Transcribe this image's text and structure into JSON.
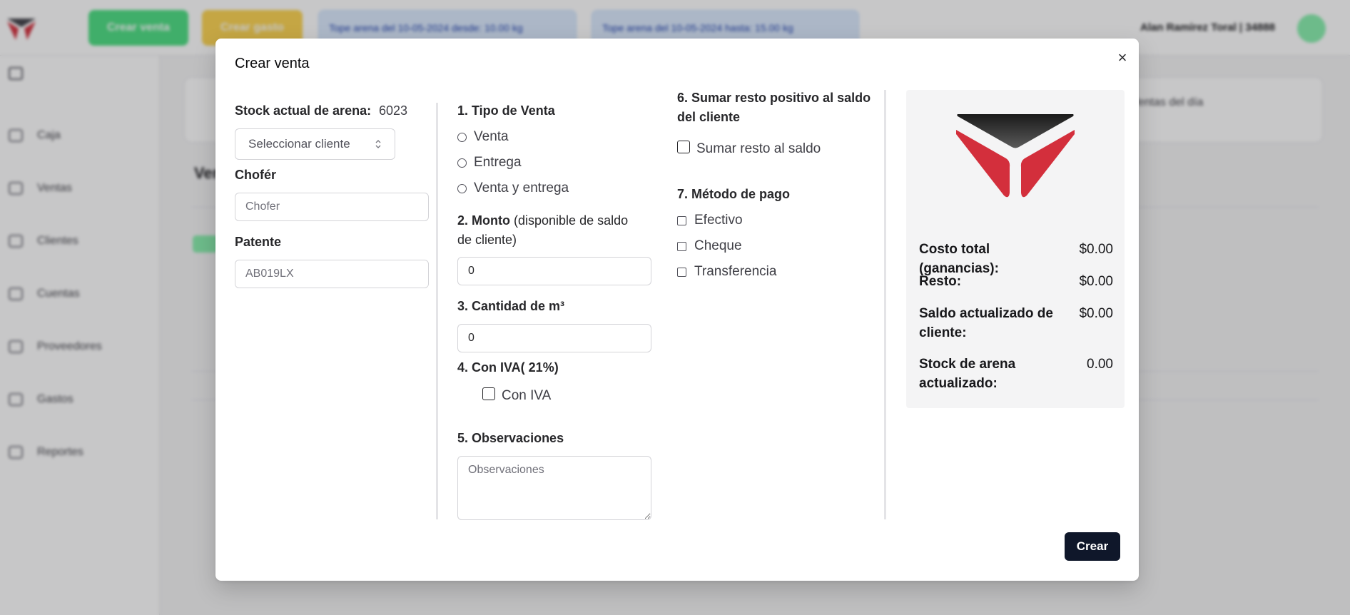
{
  "background": {
    "top_buttons": {
      "green_label": "Crear venta",
      "amber_label": "Crear gasto"
    },
    "info_pills": [
      "Tope arena del 10-05-2024 desde: 10.00 kg",
      "Tope arena del 10-05-2024 hasta: 15.00 kg"
    ],
    "user_name": "Alan Ramírez Toral | 34888",
    "sidebar_items": [
      "Caja",
      "Ventas",
      "Clientes",
      "Cuentas",
      "Proveedores",
      "Gastos",
      "Reportes"
    ],
    "card_text": "Ventas del día",
    "heading": "Ventas"
  },
  "modal": {
    "title": "Crear venta",
    "close_glyph": "×",
    "stock": {
      "label": "Stock actual de arena:",
      "value": "6023"
    },
    "client_select": {
      "value": "Seleccionar cliente",
      "chevron": "⌃⌄"
    },
    "chofer": {
      "label": "Chofér",
      "placeholder": "Chofer",
      "value": ""
    },
    "patente": {
      "label": "Patente",
      "placeholder": "AB019LX",
      "value": ""
    },
    "tipo_venta": {
      "label": "1. Tipo de Venta",
      "options": [
        "Venta",
        "Entrega",
        "Venta y entrega"
      ]
    },
    "monto": {
      "label": "2. Monto",
      "label_extra": "(disponible de saldo",
      "label_extra_2": "de cliente)",
      "value": "0"
    },
    "cantidad": {
      "label": "3. Cantidad de m³",
      "value": "0"
    },
    "iva": {
      "label": "4. Con IVA( 21%)",
      "checkbox_label": "Con IVA"
    },
    "observaciones": {
      "label": "5. Observaciones",
      "placeholder": "Observaciones"
    },
    "sumar_resto": {
      "label_line1": "6. Sumar resto positivo al saldo",
      "label_line2": "del cliente",
      "checkbox_label": "Sumar resto al saldo"
    },
    "metodo_pago": {
      "label": "7. Método de pago",
      "options": [
        "Efectivo",
        "Cheque",
        "Transferencia"
      ]
    },
    "summary": {
      "costo_total": {
        "label": "Costo total (ganancias):",
        "value": "$0.00"
      },
      "resto": {
        "label": "Resto:",
        "value": "$0.00"
      },
      "saldo": {
        "label": "Saldo actualizado de cliente:",
        "value": "$0.00"
      },
      "stock_act": {
        "label": "Stock de arena actualizado:",
        "value": "0.00"
      }
    },
    "submit_label": "Crear"
  },
  "colors": {
    "primary_button": "#0f172a",
    "logo_red": "#d32f3c",
    "logo_dark": "#2a2a2a",
    "summary_bg": "#f4f4f5"
  }
}
